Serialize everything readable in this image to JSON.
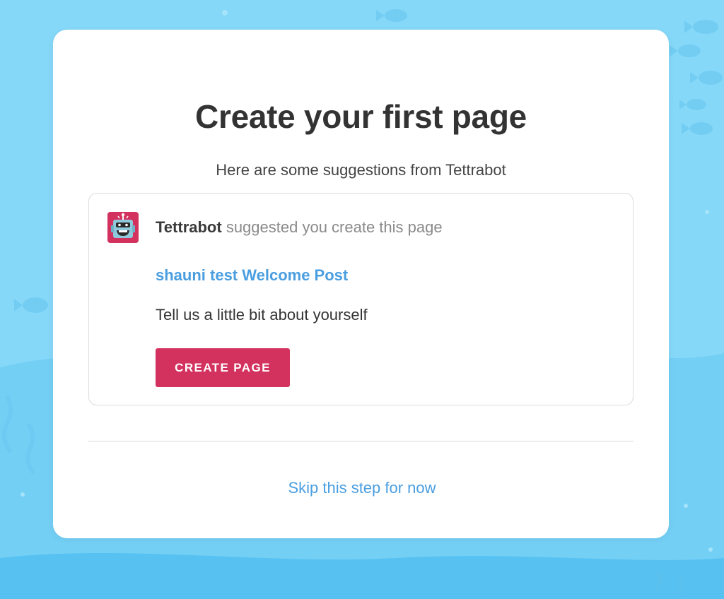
{
  "modal": {
    "title": "Create your first page",
    "subtitle": "Here are some suggestions from Tettrabot"
  },
  "suggestion": {
    "avatar_icon": "robot-icon",
    "bot_name": "Tettrabot",
    "suggested_text": " suggested you create this page",
    "page_title": "shauni test Welcome Post",
    "page_description": "Tell us a little bit about yourself",
    "button_label": "CREATE PAGE"
  },
  "footer": {
    "skip_label": "Skip this step for now"
  },
  "colors": {
    "background": "#7fd6f7",
    "accent_button": "#d3325f",
    "link": "#4a9ee0",
    "title_text": "#333333"
  }
}
